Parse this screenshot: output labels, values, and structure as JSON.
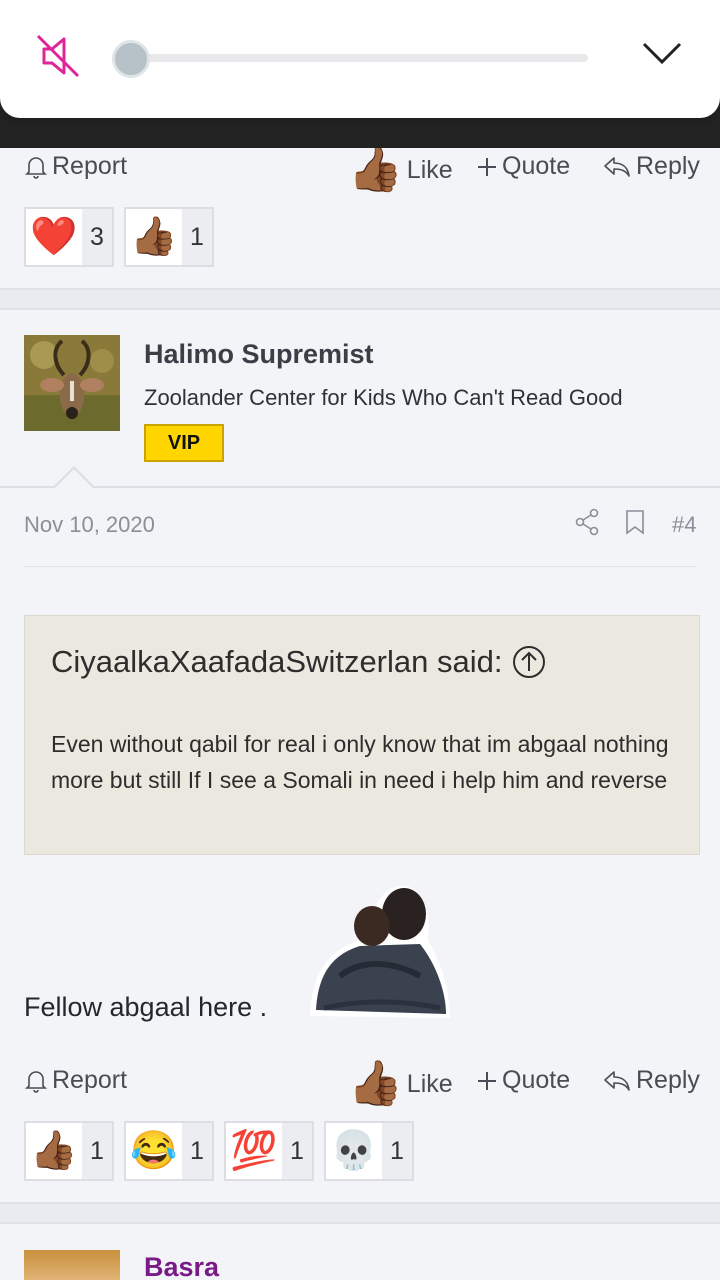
{
  "volume": {
    "level": 0.0,
    "muted": true
  },
  "post_prev": {
    "actions": {
      "report": "Report",
      "like": "Like",
      "quote": "Quote",
      "reply": "Reply"
    },
    "reactions": [
      {
        "emoji": "❤️",
        "count": "3"
      },
      {
        "emoji": "👍🏾",
        "count": "1"
      }
    ]
  },
  "post4": {
    "author": {
      "name": "Halimo Supremist",
      "title": "Zoolander Center for Kids Who Can't Read Good",
      "badge": "VIP"
    },
    "date": "Nov 10, 2020",
    "number": "#4",
    "quote": {
      "author_line": "CiyaalkaXaafadaSwitzerlan said:",
      "text": "Even without qabil for real i only know that im abgaal nothing more but still If I see a Somali in need i help him and reverse"
    },
    "body": "Fellow abgaal here .",
    "actions": {
      "report": "Report",
      "like": "Like",
      "quote": "Quote",
      "reply": "Reply"
    },
    "reactions": [
      {
        "emoji": "👍🏾",
        "count": "1"
      },
      {
        "emoji": "😂",
        "count": "1"
      },
      {
        "emoji": "💯",
        "count": "1"
      },
      {
        "emoji": "💀",
        "count": "1"
      }
    ]
  },
  "next_post": {
    "author": "Basra"
  },
  "colors": {
    "accent_mute": "#e0249a",
    "vip": "#ffd500",
    "next_author": "#7a1a86"
  }
}
